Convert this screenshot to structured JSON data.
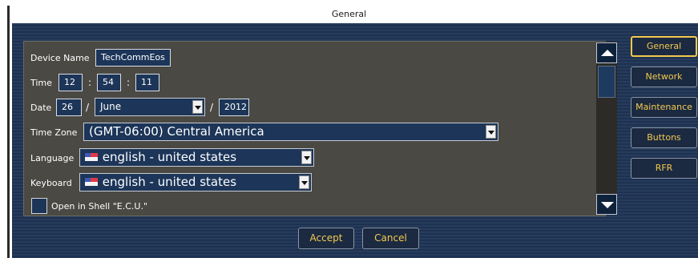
{
  "window": {
    "title": "General"
  },
  "form": {
    "device_name": {
      "label": "Device Name",
      "value": "TechCommEos"
    },
    "time": {
      "label": "Time",
      "hour": "12",
      "minute": "54",
      "second": "11",
      "separator": ":"
    },
    "date": {
      "label": "Date",
      "day": "26",
      "month": "June",
      "year": "2012",
      "separator": "/"
    },
    "time_zone": {
      "label": "Time Zone",
      "value": "(GMT-06:00) Central America"
    },
    "language": {
      "label": "Language",
      "value": "english - united states",
      "flag_icon": "us-flag-icon"
    },
    "keyboard": {
      "label": "Keyboard",
      "value": "english - united states",
      "flag_icon": "us-flag-icon"
    },
    "open_in_shell": {
      "label": "Open in Shell \"E.C.U.\"",
      "checked": false
    }
  },
  "scrollbar": {
    "up_icon": "scroll-up-arrow-icon",
    "down_icon": "scroll-down-arrow-icon"
  },
  "sidebar": {
    "items": [
      {
        "label": "General",
        "active": true
      },
      {
        "label": "Network",
        "active": false
      },
      {
        "label": "Maintenance",
        "active": false
      },
      {
        "label": "Buttons",
        "active": false
      },
      {
        "label": "RFR",
        "active": false
      }
    ]
  },
  "actions": {
    "accept_label": "Accept",
    "cancel_label": "Cancel"
  },
  "colors": {
    "accent": "#f4c84f",
    "window_bg": "#263c5c",
    "panel_bg": "#4b4944",
    "field_bg": "#1c3558"
  }
}
